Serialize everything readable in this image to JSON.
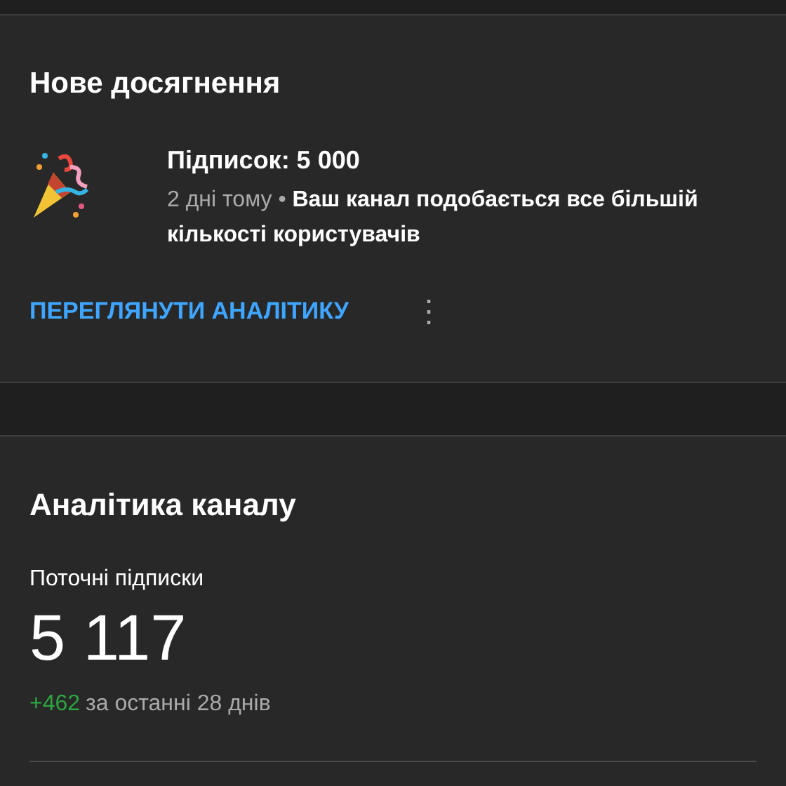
{
  "achievement_card": {
    "title": "Нове досягнення",
    "headline": "Підписок: 5 000",
    "meta": "2 дні тому • **Ваш канал подобається все більшій кількості користувачів**",
    "action": "ПЕРЕГЛЯНУТИ АНАЛІТИКУ",
    "more_icon": "⋮"
  },
  "analytics_card": {
    "title": "Аналітика каналу",
    "metric_label": "Поточні підписки",
    "metric_value": "5 117",
    "delta": "+462",
    "delta_period": "за останні 28 днів"
  }
}
